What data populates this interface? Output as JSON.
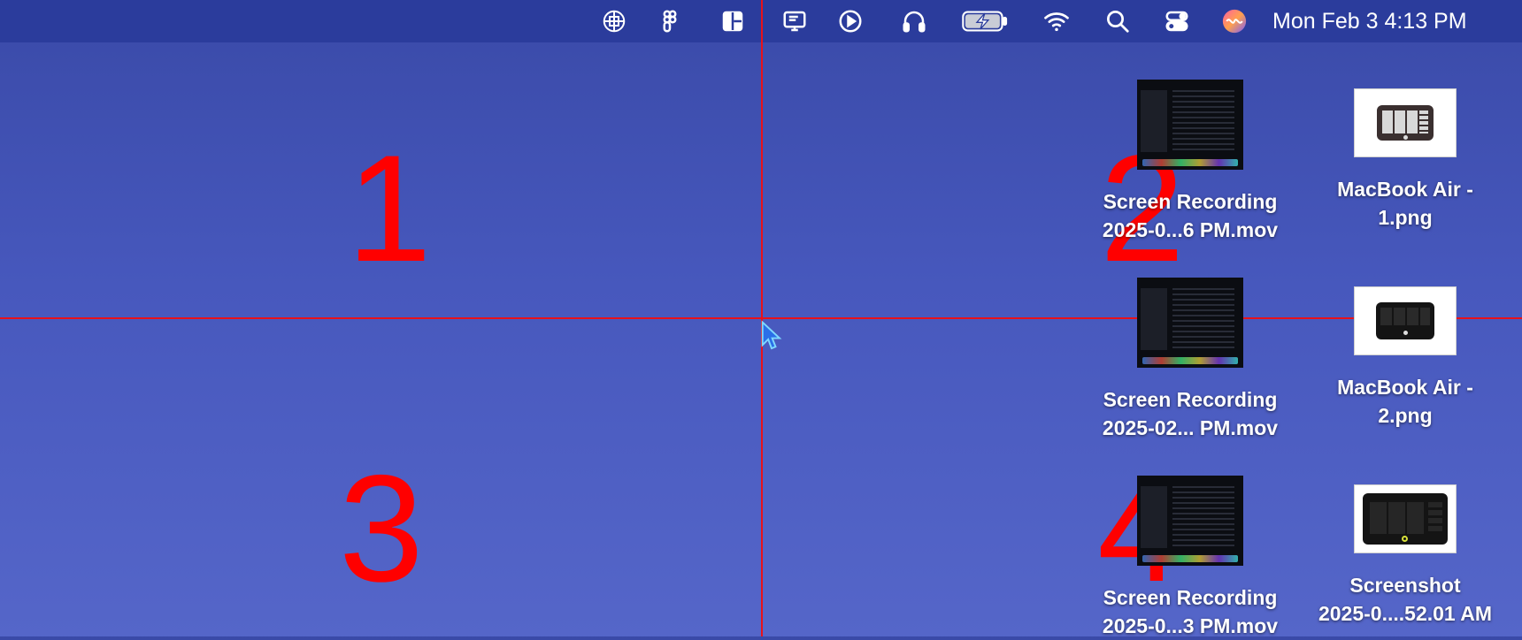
{
  "menubar": {
    "icons": [
      {
        "name": "chatgpt-icon"
      },
      {
        "name": "figma-icon"
      },
      {
        "name": "window-layout-icon"
      },
      {
        "name": "display-icon"
      },
      {
        "name": "play-circle-icon"
      },
      {
        "name": "headphones-icon"
      },
      {
        "name": "battery-charging-icon"
      },
      {
        "name": "wifi-icon"
      },
      {
        "name": "search-icon"
      },
      {
        "name": "control-center-icon"
      },
      {
        "name": "siri-icon"
      }
    ],
    "clock": "Mon Feb 3  4:13 PM"
  },
  "overlay": {
    "quadrants": [
      "1",
      "2",
      "3",
      "4"
    ],
    "line_color": "#e8121a"
  },
  "desktop": {
    "items": [
      {
        "label": "Screen Recording\n2025-0...6 PM.mov",
        "type": "mov"
      },
      {
        "label": "MacBook Air -\n1.png",
        "type": "png"
      },
      {
        "label": "Screen Recording\n2025-02... PM.mov",
        "type": "mov"
      },
      {
        "label": "MacBook Air -\n2.png",
        "type": "png"
      },
      {
        "label": "Screen Recording\n2025-0...3 PM.mov",
        "type": "mov"
      },
      {
        "label": "Screenshot\n2025-0....52.01 AM",
        "type": "png"
      }
    ]
  },
  "colors": {
    "menubar": "#2b3c9c",
    "desktop_top": "#3a4aa8",
    "desktop_bottom": "#5566c9"
  }
}
